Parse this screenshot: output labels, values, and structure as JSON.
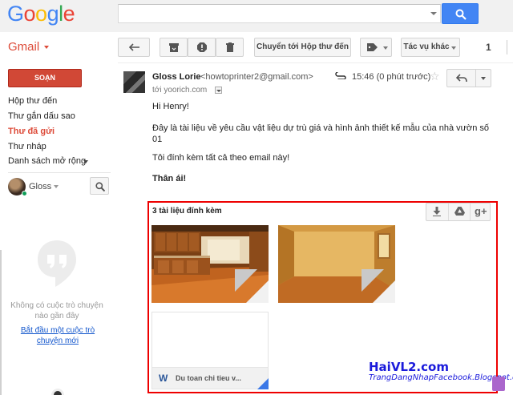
{
  "header": {
    "logo_letters": [
      "G",
      "o",
      "o",
      "g",
      "l",
      "e"
    ],
    "search_value": ""
  },
  "toolbar": {
    "app_label": "Gmail",
    "move_to_inbox": "Chuyển tới Hộp thư đến",
    "more_actions": "Tác vụ khác",
    "page_count": "1"
  },
  "nav": {
    "compose": "SOẠN",
    "items": [
      {
        "label": "Hộp thư đến",
        "active": false
      },
      {
        "label": "Thư gắn dấu sao",
        "active": false
      },
      {
        "label": "Thư đã gửi",
        "active": true
      },
      {
        "label": "Thư nháp",
        "active": false
      },
      {
        "label": "Danh sách mở rộng",
        "active": false
      }
    ]
  },
  "chat": {
    "user": "Gloss",
    "empty_text": "Không có cuộc trò chuyện nào gần đây",
    "start_link": "Bắt đầu một cuộc trò chuyện mới"
  },
  "message": {
    "sender_name": "Gloss Lorie",
    "sender_email": "<howtoprinter2@gmail.com>",
    "to": "tới yoorich.com",
    "time": "15:46 (0 phút trước)",
    "greeting": "Hi Henry!",
    "body_line1": "Đây là tài liệu về yêu cầu vật liệu dự trù giá và hình ảnh thiết kế mẫu của nhà vườn số",
    "body_line2": "01",
    "body_line3": "Tôi đính kèm tất cả theo email này!",
    "closing": "Thân ái!"
  },
  "attachments": {
    "title": "3 tài liệu đính kèm",
    "doc_name": "Du toan chi tieu v..."
  },
  "watermark": {
    "line1": "HaiVL2.com",
    "line2": "TrangDangNhapFacebook.Blogspot.com"
  },
  "colors": {
    "accent_red": "#dd4b39",
    "search_blue": "#4285f4",
    "highlight_frame": "#ee0000",
    "watermark_blue": "#1a1adb"
  },
  "icons": [
    "search-icon",
    "reply-icon",
    "archive-icon",
    "spam-icon",
    "trash-icon",
    "tag-icon",
    "paperclip-icon",
    "star-icon",
    "download-icon",
    "drive-icon",
    "google-plus-icon",
    "hangouts-icon",
    "word-icon"
  ]
}
